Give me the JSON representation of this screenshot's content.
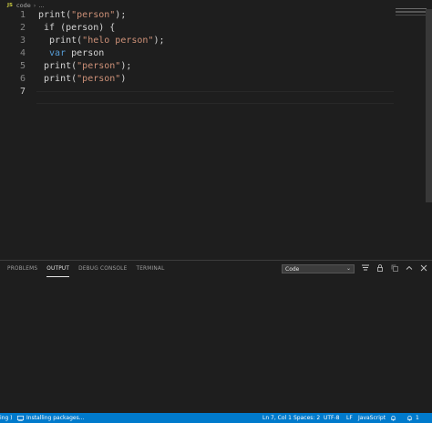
{
  "breadcrumb": {
    "lang_badge": "JS",
    "file": "code",
    "sep": "›",
    "more": "..."
  },
  "editor": {
    "lines": [
      {
        "num": "1",
        "segments": [
          {
            "t": "print(",
            "c": "plain"
          },
          {
            "t": "\"person\"",
            "c": "str"
          },
          {
            "t": ");",
            "c": "plain"
          }
        ]
      },
      {
        "num": "2",
        "segments": [
          {
            "t": " if (person) {",
            "c": "plain"
          }
        ]
      },
      {
        "num": "3",
        "segments": [
          {
            "t": "  print(",
            "c": "plain"
          },
          {
            "t": "\"helo person\"",
            "c": "str"
          },
          {
            "t": ");",
            "c": "plain"
          }
        ]
      },
      {
        "num": "4",
        "segments": [
          {
            "t": "  var",
            "c": "kw"
          },
          {
            "t": " person",
            "c": "plain"
          }
        ]
      },
      {
        "num": "5",
        "segments": [
          {
            "t": " print(",
            "c": "plain"
          },
          {
            "t": "\"person\"",
            "c": "str"
          },
          {
            "t": ");",
            "c": "plain"
          }
        ]
      },
      {
        "num": "6",
        "segments": [
          {
            "t": " print(",
            "c": "plain"
          },
          {
            "t": "\"person\"",
            "c": "str"
          },
          {
            "t": ")",
            "c": "plain"
          }
        ]
      },
      {
        "num": "7",
        "segments": []
      }
    ]
  },
  "panel": {
    "tabs": [
      "PROBLEMS",
      "OUTPUT",
      "DEBUG CONSOLE",
      "TERMINAL"
    ],
    "active_tab": "OUTPUT",
    "output_channel": "Code",
    "icons": [
      "list-filter-icon",
      "lock-icon",
      "copy-icon",
      "chevron-up-icon",
      "close-icon"
    ]
  },
  "statusbar": {
    "left_fragment": "ing )",
    "task": "Installing packages...",
    "position": "Ln 7, Col 1",
    "spaces": "Spaces: 2",
    "encoding": "UTF-8",
    "eol": "LF",
    "language": "JavaScript",
    "notifications": "1"
  },
  "colors": {
    "editor_bg": "#1e1e1e",
    "statusbar_bg": "#007acc",
    "string": "#ce9178",
    "keyword": "#569cd6"
  }
}
